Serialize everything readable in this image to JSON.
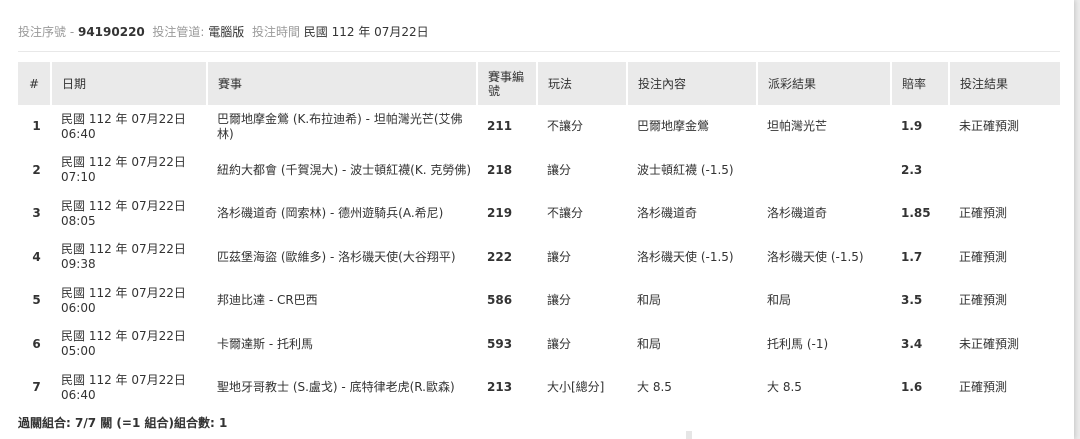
{
  "bet_info": {
    "serial_label": "投注序號 -",
    "serial_value": "94190220",
    "channel_label": "投注管道:",
    "channel_value": "電腦版",
    "time_label": "投注時間",
    "time_value": "民國 112 年 07月22日"
  },
  "table": {
    "headers": [
      "#",
      "日期",
      "賽事",
      "賽事編號",
      "玩法",
      "投注內容",
      "派彩結果",
      "賠率",
      "投注結果"
    ],
    "rows": [
      {
        "no": "1",
        "date": "民國 112 年 07月22日",
        "time": "06:40",
        "match": "巴爾地摩金鶯 (K.布拉迪希) - 坦帕灣光芒(艾佛林)",
        "match_no": "211",
        "play": "不讓分",
        "bet": "巴爾地摩金鶯",
        "payout": "坦帕灣光芒",
        "odds": "1.9",
        "result": "未正確預測"
      },
      {
        "no": "2",
        "date": "民國 112 年 07月22日",
        "time": "07:10",
        "match": "紐約大都會 (千賀滉大) - 波士頓紅襪(K. 克勞佛)",
        "match_no": "218",
        "play": "讓分",
        "bet": "波士頓紅襪 (-1.5)",
        "payout": "",
        "odds": "2.3",
        "result": ""
      },
      {
        "no": "3",
        "date": "民國 112 年 07月22日",
        "time": "08:05",
        "match": "洛杉磯道奇 (岡索林) - 德州遊騎兵(A.希尼)",
        "match_no": "219",
        "play": "不讓分",
        "bet": "洛杉磯道奇",
        "payout": "洛杉磯道奇",
        "odds": "1.85",
        "result": "正確預測"
      },
      {
        "no": "4",
        "date": "民國 112 年 07月22日",
        "time": "09:38",
        "match": "匹茲堡海盜 (歐維多) - 洛杉磯天使(大谷翔平)",
        "match_no": "222",
        "play": "讓分",
        "bet": "洛杉磯天使 (-1.5)",
        "payout": "洛杉磯天使 (-1.5)",
        "odds": "1.7",
        "result": "正確預測"
      },
      {
        "no": "5",
        "date": "民國 112 年 07月22日",
        "time": "06:00",
        "match": "邦迪比達 - CR巴西",
        "match_no": "586",
        "play": "讓分",
        "bet": "和局",
        "payout": "和局",
        "odds": "3.5",
        "result": "正確預測"
      },
      {
        "no": "6",
        "date": "民國 112 年 07月22日",
        "time": "05:00",
        "match": "卡爾達斯 - 托利馬",
        "match_no": "593",
        "play": "讓分",
        "bet": "和局",
        "payout": "托利馬 (-1)",
        "odds": "3.4",
        "result": "未正確預測"
      },
      {
        "no": "7",
        "date": "民國 112 年 07月22日",
        "time": "06:40",
        "match": "聖地牙哥教士 (S.盧戈) - 底特律老虎(R.歐森)",
        "match_no": "213",
        "play": "大小[總分]",
        "bet": "大 8.5",
        "payout": "大 8.5",
        "odds": "1.6",
        "result": "正確預測"
      }
    ]
  },
  "summary": "過關組合: 7/7 關 (=1 組合)組合數: 1"
}
